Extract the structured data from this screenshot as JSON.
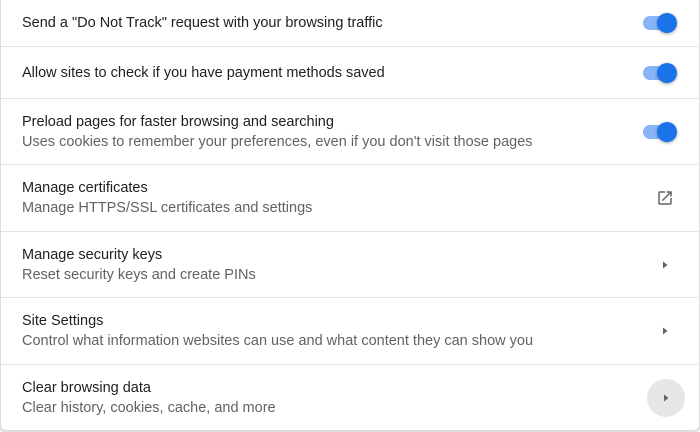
{
  "settings": [
    {
      "primary": "Send a \"Do Not Track\" request with your browsing traffic",
      "secondary": "",
      "control": "toggle",
      "checked": true
    },
    {
      "primary": "Allow sites to check if you have payment methods saved",
      "secondary": "",
      "control": "toggle",
      "checked": true
    },
    {
      "primary": "Preload pages for faster browsing and searching",
      "secondary": "Uses cookies to remember your preferences, even if you don't visit those pages",
      "control": "toggle",
      "checked": true
    },
    {
      "primary": "Manage certificates",
      "secondary": "Manage HTTPS/SSL certificates and settings",
      "control": "external-link-icon"
    },
    {
      "primary": "Manage security keys",
      "secondary": "Reset security keys and create PINs",
      "control": "chevron-right-icon"
    },
    {
      "primary": "Site Settings",
      "secondary": "Control what information websites can use and what content they can show you",
      "control": "chevron-right-icon"
    },
    {
      "primary": "Clear browsing data",
      "secondary": "Clear history, cookies, cache, and more",
      "control": "chevron-right-icon",
      "hovered": true
    }
  ],
  "colors": {
    "toggle_knob": "#1a73e8",
    "toggle_track": "#8ab4f8",
    "secondary_text": "#5f6368",
    "icon": "#5f6368"
  }
}
